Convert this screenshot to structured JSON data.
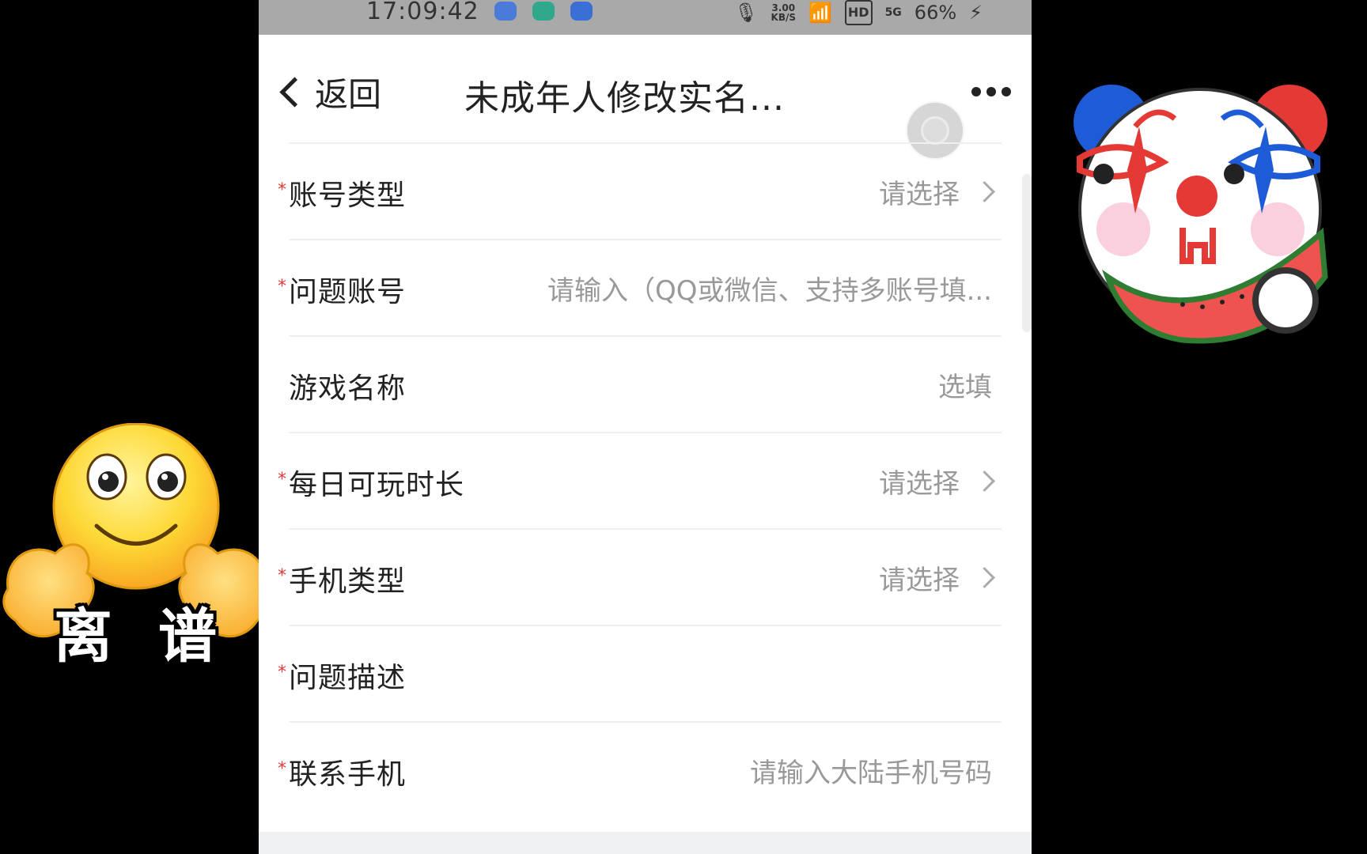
{
  "status_bar": {
    "time": "17:09:42",
    "speed_value": "3.00",
    "speed_unit": "KB/S",
    "hd": "HD",
    "network": "5G",
    "battery": "66%"
  },
  "nav": {
    "back_label": "返回",
    "title": "未成年人修改实名..."
  },
  "form": {
    "rows": [
      {
        "label": "账号类型",
        "value": "请选择",
        "required": "*"
      },
      {
        "label": "问题账号",
        "value": "请输入（QQ或微信、支持多账号填...",
        "required": "*"
      },
      {
        "label": "游戏名称",
        "value": "选填",
        "required": ""
      },
      {
        "label": "每日可玩时长",
        "value": "请选择",
        "required": "*"
      },
      {
        "label": "手机类型",
        "value": "请选择",
        "required": "*"
      },
      {
        "label": "问题描述",
        "value": "",
        "required": "*"
      },
      {
        "label": "联系手机",
        "value": "请输入大陆手机号码",
        "required": "*"
      }
    ]
  },
  "stickers": {
    "left_text": "离谱"
  },
  "colors": {
    "required_mark": "#e53935",
    "placeholder": "#999999",
    "status_bar_bg": "#a9a9a9"
  }
}
